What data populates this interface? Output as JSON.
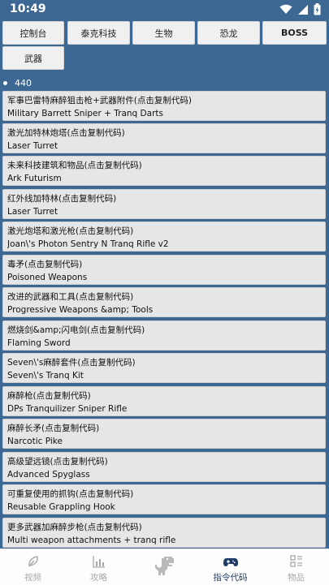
{
  "status": {
    "time": "10:49"
  },
  "tabs": [
    {
      "label": "控制台"
    },
    {
      "label": "泰克科技"
    },
    {
      "label": "生物"
    },
    {
      "label": "恐龙"
    },
    {
      "label": "BOSS"
    },
    {
      "label": "武器"
    }
  ],
  "count": "440",
  "items": [
    {
      "title": "军事巴雷特麻醉狙击枪+武器附件(点击复制代码)",
      "sub": "Military Barrett Sniper + Tranq Darts"
    },
    {
      "title": "激光加特林炮塔(点击复制代码)",
      "sub": "Laser Turret"
    },
    {
      "title": "未来科技建筑和物品(点击复制代码)",
      "sub": "Ark Futurism"
    },
    {
      "title": "红外线加特林(点击复制代码)",
      "sub": "Laser Turret"
    },
    {
      "title": "激光炮塔和激光枪(点击复制代码)",
      "sub": "Joan\\'s Photon Sentry N Tranq Rifle v2"
    },
    {
      "title": "毒矛(点击复制代码)",
      "sub": "Poisoned Weapons"
    },
    {
      "title": "改进的武器和工具(点击复制代码)",
      "sub": "Progressive Weapons &amp; Tools"
    },
    {
      "title": "燃烧剑&amp;闪电剑(点击复制代码)",
      "sub": "Flaming Sword"
    },
    {
      "title": "Seven\\'s麻醉套件(点击复制代码)",
      "sub": "Seven\\'s Tranq Kit"
    },
    {
      "title": "麻醉枪(点击复制代码)",
      "sub": "DPs Tranquilizer Sniper Rifle"
    },
    {
      "title": "麻醉长矛(点击复制代码)",
      "sub": "Narcotic Pike"
    },
    {
      "title": "高级望远镜(点击复制代码)",
      "sub": "Advanced Spyglass"
    },
    {
      "title": "可重复使用的抓钩(点击复制代码)",
      "sub": "Reusable Grappling Hook"
    },
    {
      "title": "更多武器加麻醉步枪(点击复制代码)",
      "sub": "Multi weapon attachments + tranq rifle"
    }
  ],
  "nav": [
    {
      "label": "视频",
      "icon": "leaf-icon"
    },
    {
      "label": "攻略",
      "icon": "bar-chart-icon"
    },
    {
      "label": "",
      "icon": "dinosaur-icon"
    },
    {
      "label": "指令代码",
      "icon": "gamepad-icon"
    },
    {
      "label": "物品",
      "icon": "grid-list-icon"
    }
  ],
  "colors": {
    "header": "#3d6894",
    "tile": "#e6e6e6",
    "nav_active": "#1e3a66",
    "nav_inactive": "#a8a8a8"
  }
}
